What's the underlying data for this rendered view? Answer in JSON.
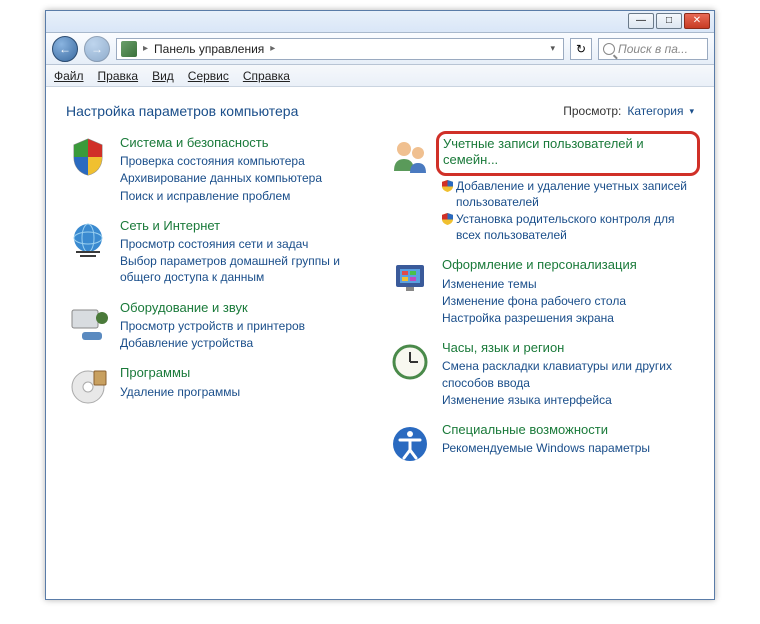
{
  "window": {
    "minimize": "—",
    "maximize": "□",
    "close": "✕"
  },
  "nav": {
    "back": "←",
    "forward": "→",
    "refresh": "↻",
    "address_label": "Панель управления",
    "address_sep": "▸",
    "dropdown": "▾"
  },
  "search": {
    "placeholder": "Поиск в па..."
  },
  "menu": {
    "file": "Файл",
    "edit": "Правка",
    "view": "Вид",
    "tools": "Сервис",
    "help": "Справка"
  },
  "header": {
    "title": "Настройка параметров компьютера",
    "view_label": "Просмотр:",
    "view_value": "Категория",
    "view_arrow": "▾"
  },
  "left": [
    {
      "title": "Система и безопасность",
      "links": [
        {
          "text": "Проверка состояния компьютера",
          "shield": false
        },
        {
          "text": "Архивирование данных компьютера",
          "shield": false
        },
        {
          "text": "Поиск и исправление проблем",
          "shield": false
        }
      ]
    },
    {
      "title": "Сеть и Интернет",
      "links": [
        {
          "text": "Просмотр состояния сети и задач",
          "shield": false
        },
        {
          "text": "Выбор параметров домашней группы и общего доступа к данным",
          "shield": false
        }
      ]
    },
    {
      "title": "Оборудование и звук",
      "links": [
        {
          "text": "Просмотр устройств и принтеров",
          "shield": false
        },
        {
          "text": "Добавление устройства",
          "shield": false
        }
      ]
    },
    {
      "title": "Программы",
      "links": [
        {
          "text": "Удаление программы",
          "shield": false
        }
      ]
    }
  ],
  "right": [
    {
      "title": "Учетные записи пользователей и семейн...",
      "highlight": true,
      "links": [
        {
          "text": "Добавление и удаление учетных записей пользователей",
          "shield": true
        },
        {
          "text": "Установка родительского контроля для всех пользователей",
          "shield": true
        }
      ]
    },
    {
      "title": "Оформление и персонализация",
      "links": [
        {
          "text": "Изменение темы",
          "shield": false
        },
        {
          "text": "Изменение фона рабочего стола",
          "shield": false
        },
        {
          "text": "Настройка разрешения экрана",
          "shield": false
        }
      ]
    },
    {
      "title": "Часы, язык и регион",
      "links": [
        {
          "text": "Смена раскладки клавиатуры или других способов ввода",
          "shield": false
        },
        {
          "text": "Изменение языка интерфейса",
          "shield": false
        }
      ]
    },
    {
      "title": "Специальные возможности",
      "links": [
        {
          "text": "Рекомендуемые Windows параметры",
          "shield": false
        }
      ]
    }
  ]
}
